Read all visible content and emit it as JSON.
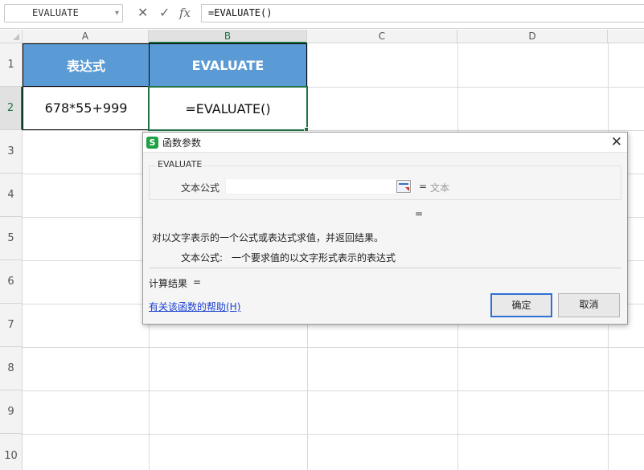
{
  "formula_bar": {
    "name_box": "EVALUATE",
    "name_box_dropdown": "▾",
    "cancel_symbol": "✕",
    "confirm_symbol": "✓",
    "fx_symbol": "fx",
    "formula": "=EVALUATE()"
  },
  "sheet": {
    "columns": [
      "A",
      "B",
      "C",
      "D"
    ],
    "rows": [
      "1",
      "2",
      "3",
      "4",
      "5",
      "6",
      "7",
      "8",
      "9",
      "10"
    ],
    "header_color": "#5b9bd5",
    "selection_color": "#217346",
    "cells": {
      "a1": "表达式",
      "b1": "EVALUATE",
      "a2": "678*55+999",
      "b2": "=EVALUATE()"
    }
  },
  "dialog": {
    "title": "函数参数",
    "logo_letter": "S",
    "close_symbol": "✕",
    "function_name": "EVALUATE",
    "arg_label": "文本公式",
    "arg_value": "",
    "arg_equals": "=",
    "arg_hint": "文本",
    "result_preview_equals": "=",
    "description": "对以文字表示的一个公式或表达式求值，并返回结果。",
    "param_desc_label": "文本公式:",
    "param_desc_text": "一个要求值的以文字形式表示的表达式",
    "result_label": "计算结果",
    "result_equals": "=",
    "help_link": "有关该函数的帮助(H)",
    "ok_label": "确定",
    "cancel_label": "取消"
  }
}
